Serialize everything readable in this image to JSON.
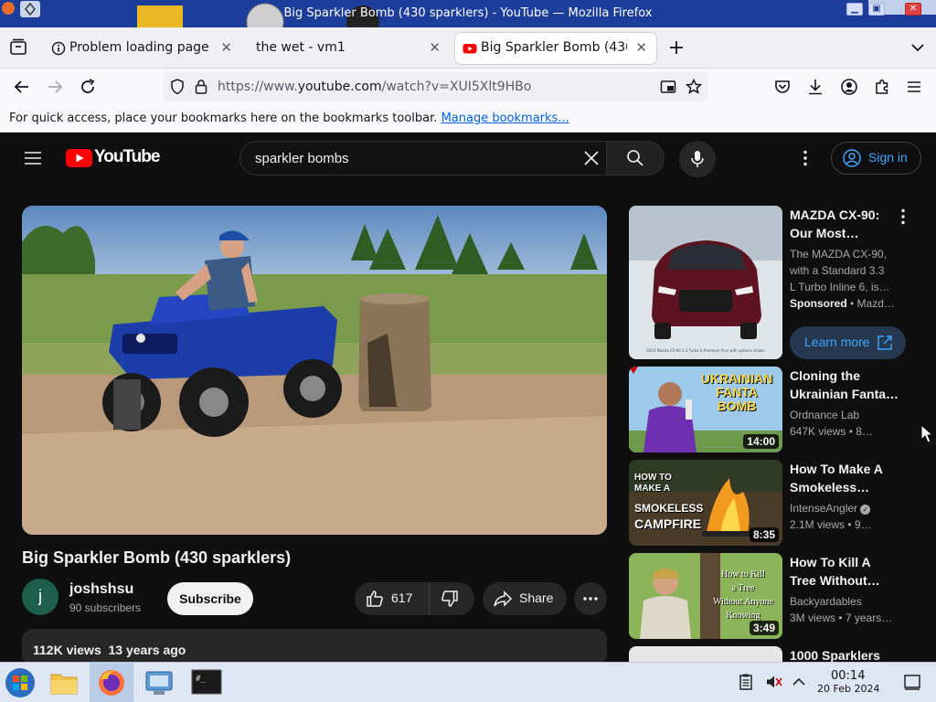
{
  "window": {
    "title": "Big Sparkler Bomb (430 sparklers) - YouTube — Mozilla Firefox",
    "controls": [
      "minimize-icon",
      "maximize-icon",
      "close-icon"
    ]
  },
  "tabs": [
    {
      "label": "Problem loading page",
      "icon": "info-icon",
      "active": false
    },
    {
      "label": "the wet - vm1",
      "icon": "",
      "active": false
    },
    {
      "label": "Big Sparkler Bomb (430",
      "icon": "youtube-icon",
      "active": true
    }
  ],
  "nav": {
    "url_prefix": "https://www.",
    "url_domain": "youtube.com",
    "url_path": "/watch?v=XUI5Xlt9HBo"
  },
  "bookmarks_bar": {
    "text": "For quick access, place your bookmarks here on the bookmarks toolbar.",
    "link": "Manage bookmarks..."
  },
  "youtube": {
    "logo_text": "YouTube",
    "search_value": "sparkler bombs",
    "signin_label": "Sign in",
    "video": {
      "title": "Big Sparkler Bomb (430 sparklers)",
      "channel_initial": "j",
      "channel_name": "joshshsu",
      "subscribers": "90 subscribers",
      "subscribe_label": "Subscribe",
      "likes": "617",
      "share_label": "Share",
      "views": "112K views",
      "age": "13 years ago"
    },
    "recommendations": [
      {
        "title_l1": "MAZDA CX-90:",
        "title_l2": "Our Most…",
        "desc_l1": "The MAZDA CX-90,",
        "desc_l2": "with a Standard 3.3",
        "desc_l3": "L Turbo Inline 6, is…",
        "sponsored": "Sponsored",
        "advertiser": " • Mazd…",
        "cta": "Learn more",
        "thumb_caption": "2024 Mazda CX-90 3.3 Turbo S Premium Plus with options shown"
      },
      {
        "title_l1": "Cloning the",
        "title_l2": "Ukrainian Fanta…",
        "channel": "Ordnance Lab",
        "meta": "647K views  • 8…",
        "duration": "14:00",
        "thumb_text": [
          "UKRAINIAN",
          "FANTA",
          "BOMB"
        ]
      },
      {
        "title_l1": "How To Make A",
        "title_l2": "Smokeless…",
        "channel": "IntenseAngler",
        "meta": "2.1M views  • 9…",
        "duration": "8:35",
        "thumb_text": [
          "HOW TO",
          "MAKE A",
          "SMOKELESS",
          "CAMPFIRE"
        ]
      },
      {
        "title_l1": "How To Kill A",
        "title_l2": "Tree Without…",
        "channel": "Backyardables",
        "meta": "3M views  • 7 years…",
        "duration": "3:49",
        "thumb_text": [
          "How to Kill",
          "a Tree",
          "Without Anyone",
          "Knowing"
        ]
      },
      {
        "title_l1": "1000 Sparklers",
        "title_l2": "",
        "channel": "",
        "meta": "",
        "duration": ""
      }
    ]
  },
  "taskbar": {
    "time": "00:14",
    "date": "20 Feb 2024",
    "apps": [
      "start-orb-icon",
      "file-manager-icon",
      "firefox-icon",
      "control-panel-icon",
      "terminal-icon"
    ],
    "tray": [
      "clipboard-icon",
      "volume-muted-icon",
      "tray-chevron-icon",
      "show-desktop-icon"
    ]
  },
  "colors": {
    "accent": "#ff0000",
    "link": "#3ea6ff",
    "titlebar": "#1c3e9a"
  }
}
